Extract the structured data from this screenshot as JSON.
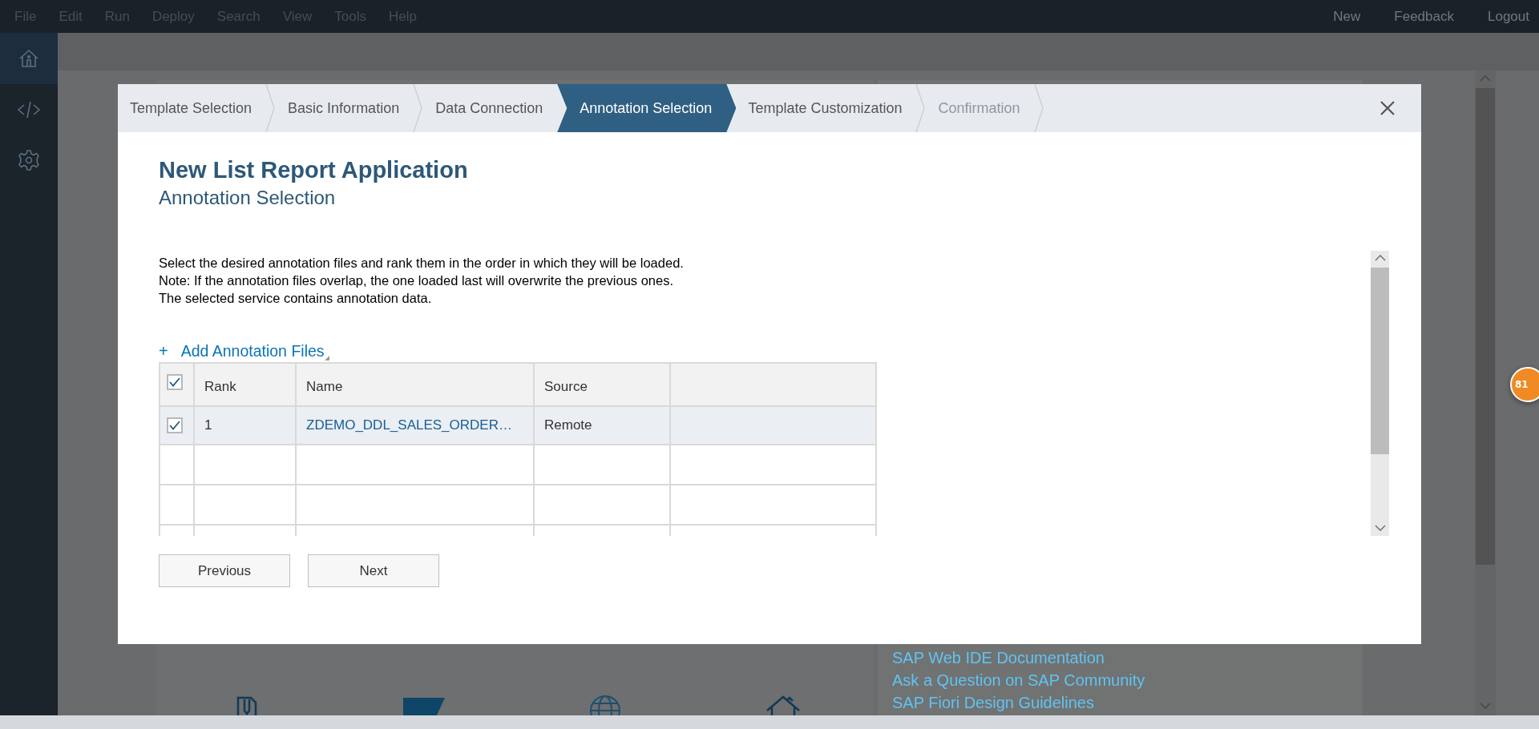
{
  "menu": {
    "left": [
      "File",
      "Edit",
      "Run",
      "Deploy",
      "Search",
      "View",
      "Tools",
      "Help"
    ],
    "right": [
      "New",
      "Feedback",
      "Logout"
    ]
  },
  "sidebar": {
    "items": [
      {
        "kind": "home",
        "selected": true
      },
      {
        "kind": "code",
        "selected": false
      },
      {
        "kind": "settings",
        "selected": false
      }
    ]
  },
  "background": {
    "links": [
      "SAP Web IDE Documentation",
      "Ask a Question on SAP Community",
      "SAP Fiori Design Guidelines"
    ],
    "badge": "81"
  },
  "dialog": {
    "steps": [
      {
        "label": "Template Selection",
        "selected": false,
        "disabled": false
      },
      {
        "label": "Basic Information",
        "selected": false,
        "disabled": false
      },
      {
        "label": "Data Connection",
        "selected": false,
        "disabled": false
      },
      {
        "label": "Annotation Selection",
        "selected": true,
        "disabled": false
      },
      {
        "label": "Template Customization",
        "selected": false,
        "disabled": false
      },
      {
        "label": "Confirmation",
        "selected": false,
        "disabled": true
      }
    ],
    "title": "New List Report Application",
    "subtitle": "Annotation Selection",
    "description": [
      "Select the desired annotation files and rank them in the order in which they will be loaded.",
      "Note: If the annotation files overlap, the one loaded last will overwrite the previous ones.",
      "The selected service contains annotation data."
    ],
    "add_link": {
      "icon": "+",
      "label": "Add Annotation Files"
    },
    "table": {
      "all_checked": true,
      "columns": [
        "Rank",
        "Name",
        "Source"
      ],
      "rows": [
        {
          "checked": true,
          "selected": true,
          "rank": "1",
          "name": "ZDEMO_DDL_SALES_ORDER…",
          "source": "Remote"
        }
      ]
    },
    "buttons": [
      "Previous",
      "Next"
    ]
  }
}
